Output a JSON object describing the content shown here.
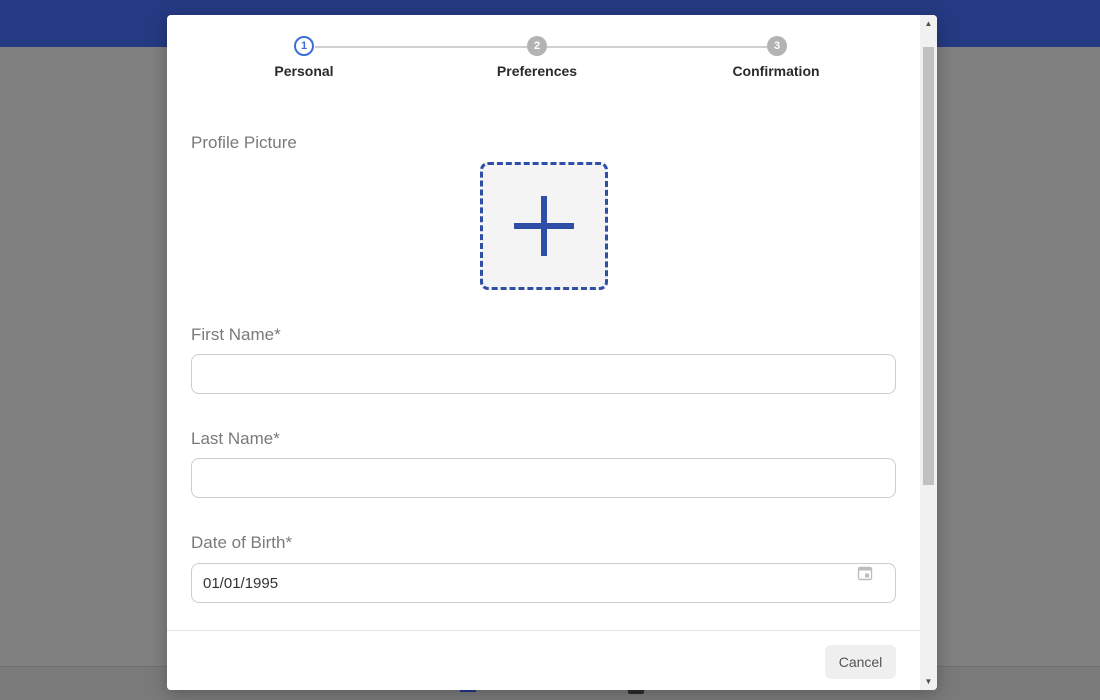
{
  "stepper": {
    "steps": [
      {
        "number": "1",
        "label": "Personal",
        "state": "active"
      },
      {
        "number": "2",
        "label": "Preferences",
        "state": "inactive"
      },
      {
        "number": "3",
        "label": "Confirmation",
        "state": "inactive"
      }
    ]
  },
  "form": {
    "profile_picture_label": "Profile Picture",
    "upload_icon": "plus-icon",
    "first_name": {
      "label": "First Name*",
      "value": ""
    },
    "last_name": {
      "label": "Last Name*",
      "value": ""
    },
    "date_of_birth": {
      "label": "Date of Birth*",
      "value": "01/01/1995",
      "icon": "calendar-icon"
    }
  },
  "footer": {
    "cancel_label": "Cancel"
  },
  "colors": {
    "brand_blue": "#243a82",
    "accent_blue": "#2f4ea8",
    "active_step": "#3b6fd6",
    "inactive_step": "#b3b3b3",
    "overlay": "#808080"
  }
}
